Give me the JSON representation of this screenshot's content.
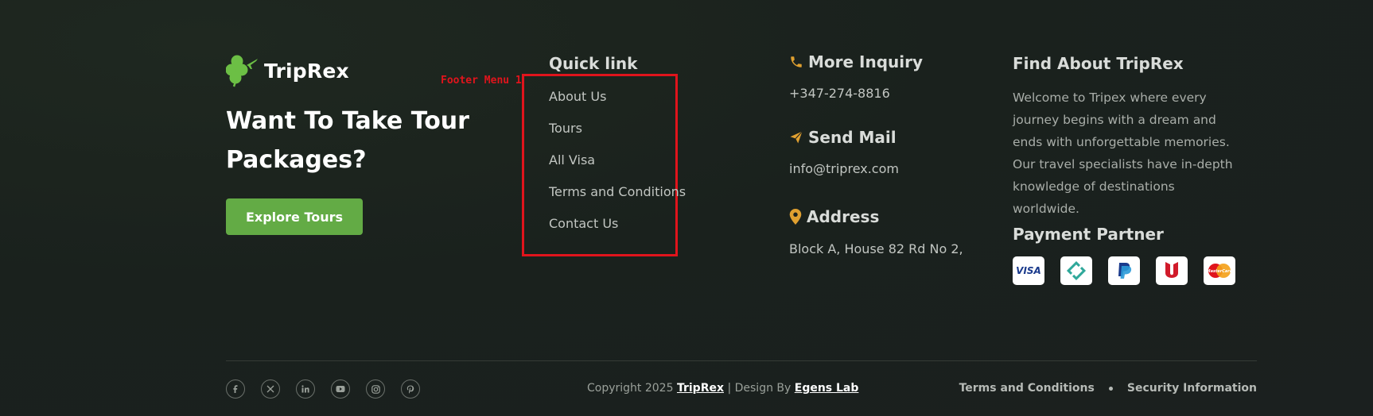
{
  "brand": {
    "name": "TripRex",
    "logo_icon": "clover-plane-icon",
    "tagline": "Want To Take Tour Packages?",
    "cta_label": "Explore Tours"
  },
  "annotation": {
    "label": "Footer Menu 1"
  },
  "quick_links": {
    "title": "Quick link",
    "items": [
      "About Us",
      "Tours",
      "All Visa",
      "Terms and Conditions",
      "Contact Us"
    ]
  },
  "contact": {
    "inquiry": {
      "title": "More Inquiry",
      "value": "+347-274-8816",
      "icon": "phone-icon"
    },
    "mail": {
      "title": "Send Mail",
      "value": "info@triprex.com",
      "icon": "paper-plane-icon"
    },
    "address": {
      "title": "Address",
      "value": "Block A, House 82 Rd No 2,",
      "icon": "map-pin-icon"
    }
  },
  "about": {
    "title": "Find About TripRex",
    "text": "Welcome to Tripex where every journey begins with a dream and ends with unforgettable memories. Our travel specialists have in-depth knowledge of destinations worldwide."
  },
  "payment": {
    "title": "Payment Partner",
    "partners": [
      "visa-icon",
      "payoneer-icon",
      "paypal-icon",
      "bank-icon",
      "mastercard-icon"
    ],
    "visa_text": "VISA",
    "mastercard_text": "MasterCard"
  },
  "footer": {
    "socials": [
      "facebook-icon",
      "x-icon",
      "linkedin-icon",
      "youtube-icon",
      "instagram-icon",
      "pinterest-icon"
    ],
    "copyright_prefix": "Copyright 2025",
    "brand_link": "TripRex",
    "design_by": "| Design By",
    "designer_link": "Egens Lab",
    "terms": "Terms and Conditions",
    "security": "Security Information"
  },
  "colors": {
    "accent_green": "#63ab45",
    "icon_orange": "#e0a030",
    "annotation_red": "#e0141c"
  }
}
